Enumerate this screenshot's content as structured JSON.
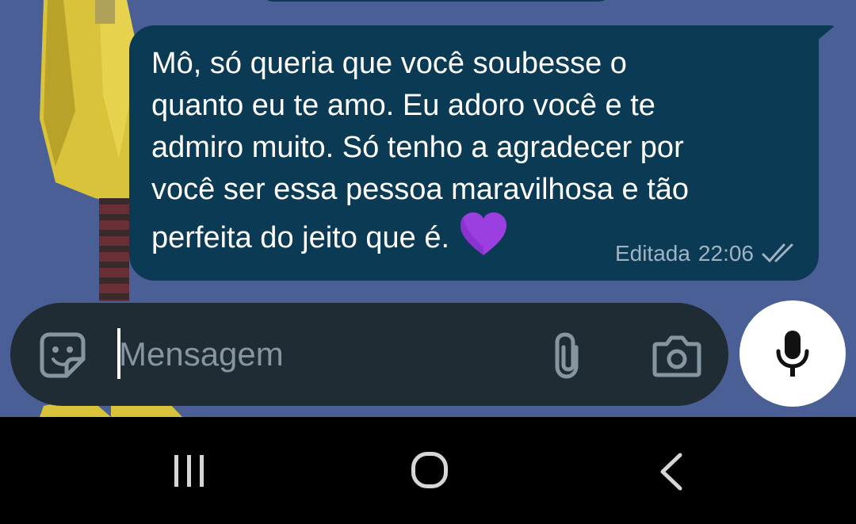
{
  "conversation": {
    "message": {
      "text": "Mô, só queria que você soubesse o\nquanto eu te amo. Eu adoro você e te\nadmiro muito. Só tenho a agradecer por\nvocê ser essa pessoa maravilhosa e tão\nperfeita do jeito que é.",
      "emoji": "purple-heart",
      "edited_label": "Editada",
      "time": "22:06",
      "status": "read",
      "bubble_color": "#0b3a54",
      "ticks_color": "#9fb3c4"
    },
    "wallpaper_color": "#4a5f95"
  },
  "composer": {
    "placeholder": "Mensagem",
    "background": "#1f2c34",
    "icons": [
      "sticker-icon",
      "attach-icon",
      "camera-icon"
    ],
    "mic_icon": "mic-icon"
  },
  "navigation": {
    "buttons": [
      "recents-icon",
      "home-icon",
      "back-icon"
    ]
  }
}
